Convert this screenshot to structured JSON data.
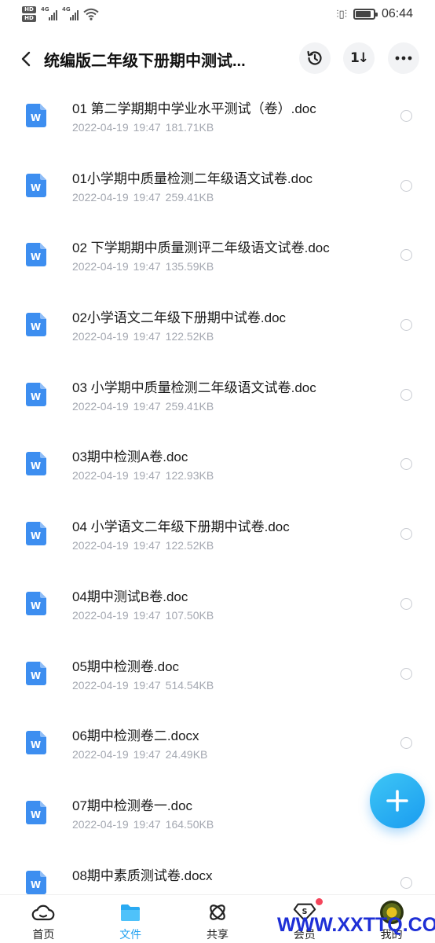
{
  "status_bar": {
    "time": "06:44",
    "hd1": "HD",
    "hd2": "HD",
    "net1": "4G",
    "net2": "4G",
    "battery_level": 0.85,
    "icons": [
      "signal-icon",
      "wifi-icon",
      "vibrate-icon",
      "battery-icon"
    ]
  },
  "header": {
    "title": "统编版二年级下册期中测试...",
    "sort_glyph": "1↓",
    "icons": [
      "back-icon",
      "history-icon",
      "sort-icon",
      "more-icon"
    ]
  },
  "files": [
    {
      "name": "01 第二学期期中学业水平测试（卷）.doc",
      "date": "2022-04-19",
      "time": "19:47",
      "size": "181.71KB"
    },
    {
      "name": "01小学期中质量检测二年级语文试卷.doc",
      "date": "2022-04-19",
      "time": "19:47",
      "size": "259.41KB"
    },
    {
      "name": "02 下学期期中质量测评二年级语文试卷.doc",
      "date": "2022-04-19",
      "time": "19:47",
      "size": "135.59KB"
    },
    {
      "name": "02小学语文二年级下册期中试卷.doc",
      "date": "2022-04-19",
      "time": "19:47",
      "size": "122.52KB"
    },
    {
      "name": "03 小学期中质量检测二年级语文试卷.doc",
      "date": "2022-04-19",
      "time": "19:47",
      "size": "259.41KB"
    },
    {
      "name": "03期中检测A卷.doc",
      "date": "2022-04-19",
      "time": "19:47",
      "size": "122.93KB"
    },
    {
      "name": "04 小学语文二年级下册期中试卷.doc",
      "date": "2022-04-19",
      "time": "19:47",
      "size": "122.52KB"
    },
    {
      "name": "04期中测试B卷.doc",
      "date": "2022-04-19",
      "time": "19:47",
      "size": "107.50KB"
    },
    {
      "name": "05期中检测卷.doc",
      "date": "2022-04-19",
      "time": "19:47",
      "size": "514.54KB"
    },
    {
      "name": "06期中检测卷二.docx",
      "date": "2022-04-19",
      "time": "19:47",
      "size": "24.49KB"
    },
    {
      "name": "07期中检测卷一.doc",
      "date": "2022-04-19",
      "time": "19:47",
      "size": "164.50KB"
    },
    {
      "name": "08期中素质测试卷.docx",
      "date": "",
      "time": "",
      "size": ""
    }
  ],
  "file_icon_letter": "W",
  "colors": {
    "accent": "#1fa0f0",
    "doc_icon": "#3d8ef0",
    "meta_text": "#a3a7b0",
    "badge": "#f5455b"
  },
  "bottom_nav": [
    {
      "label": "首页",
      "icon": "cloud-home-icon",
      "active": false
    },
    {
      "label": "文件",
      "icon": "folder-icon",
      "active": true
    },
    {
      "label": "共享",
      "icon": "share-icon",
      "active": false
    },
    {
      "label": "会员",
      "icon": "vip-icon",
      "active": false
    },
    {
      "label": "我的",
      "icon": "avatar",
      "active": false
    }
  ],
  "vip_glyph": "S",
  "watermark": "WWW.XXTTQ.COM"
}
